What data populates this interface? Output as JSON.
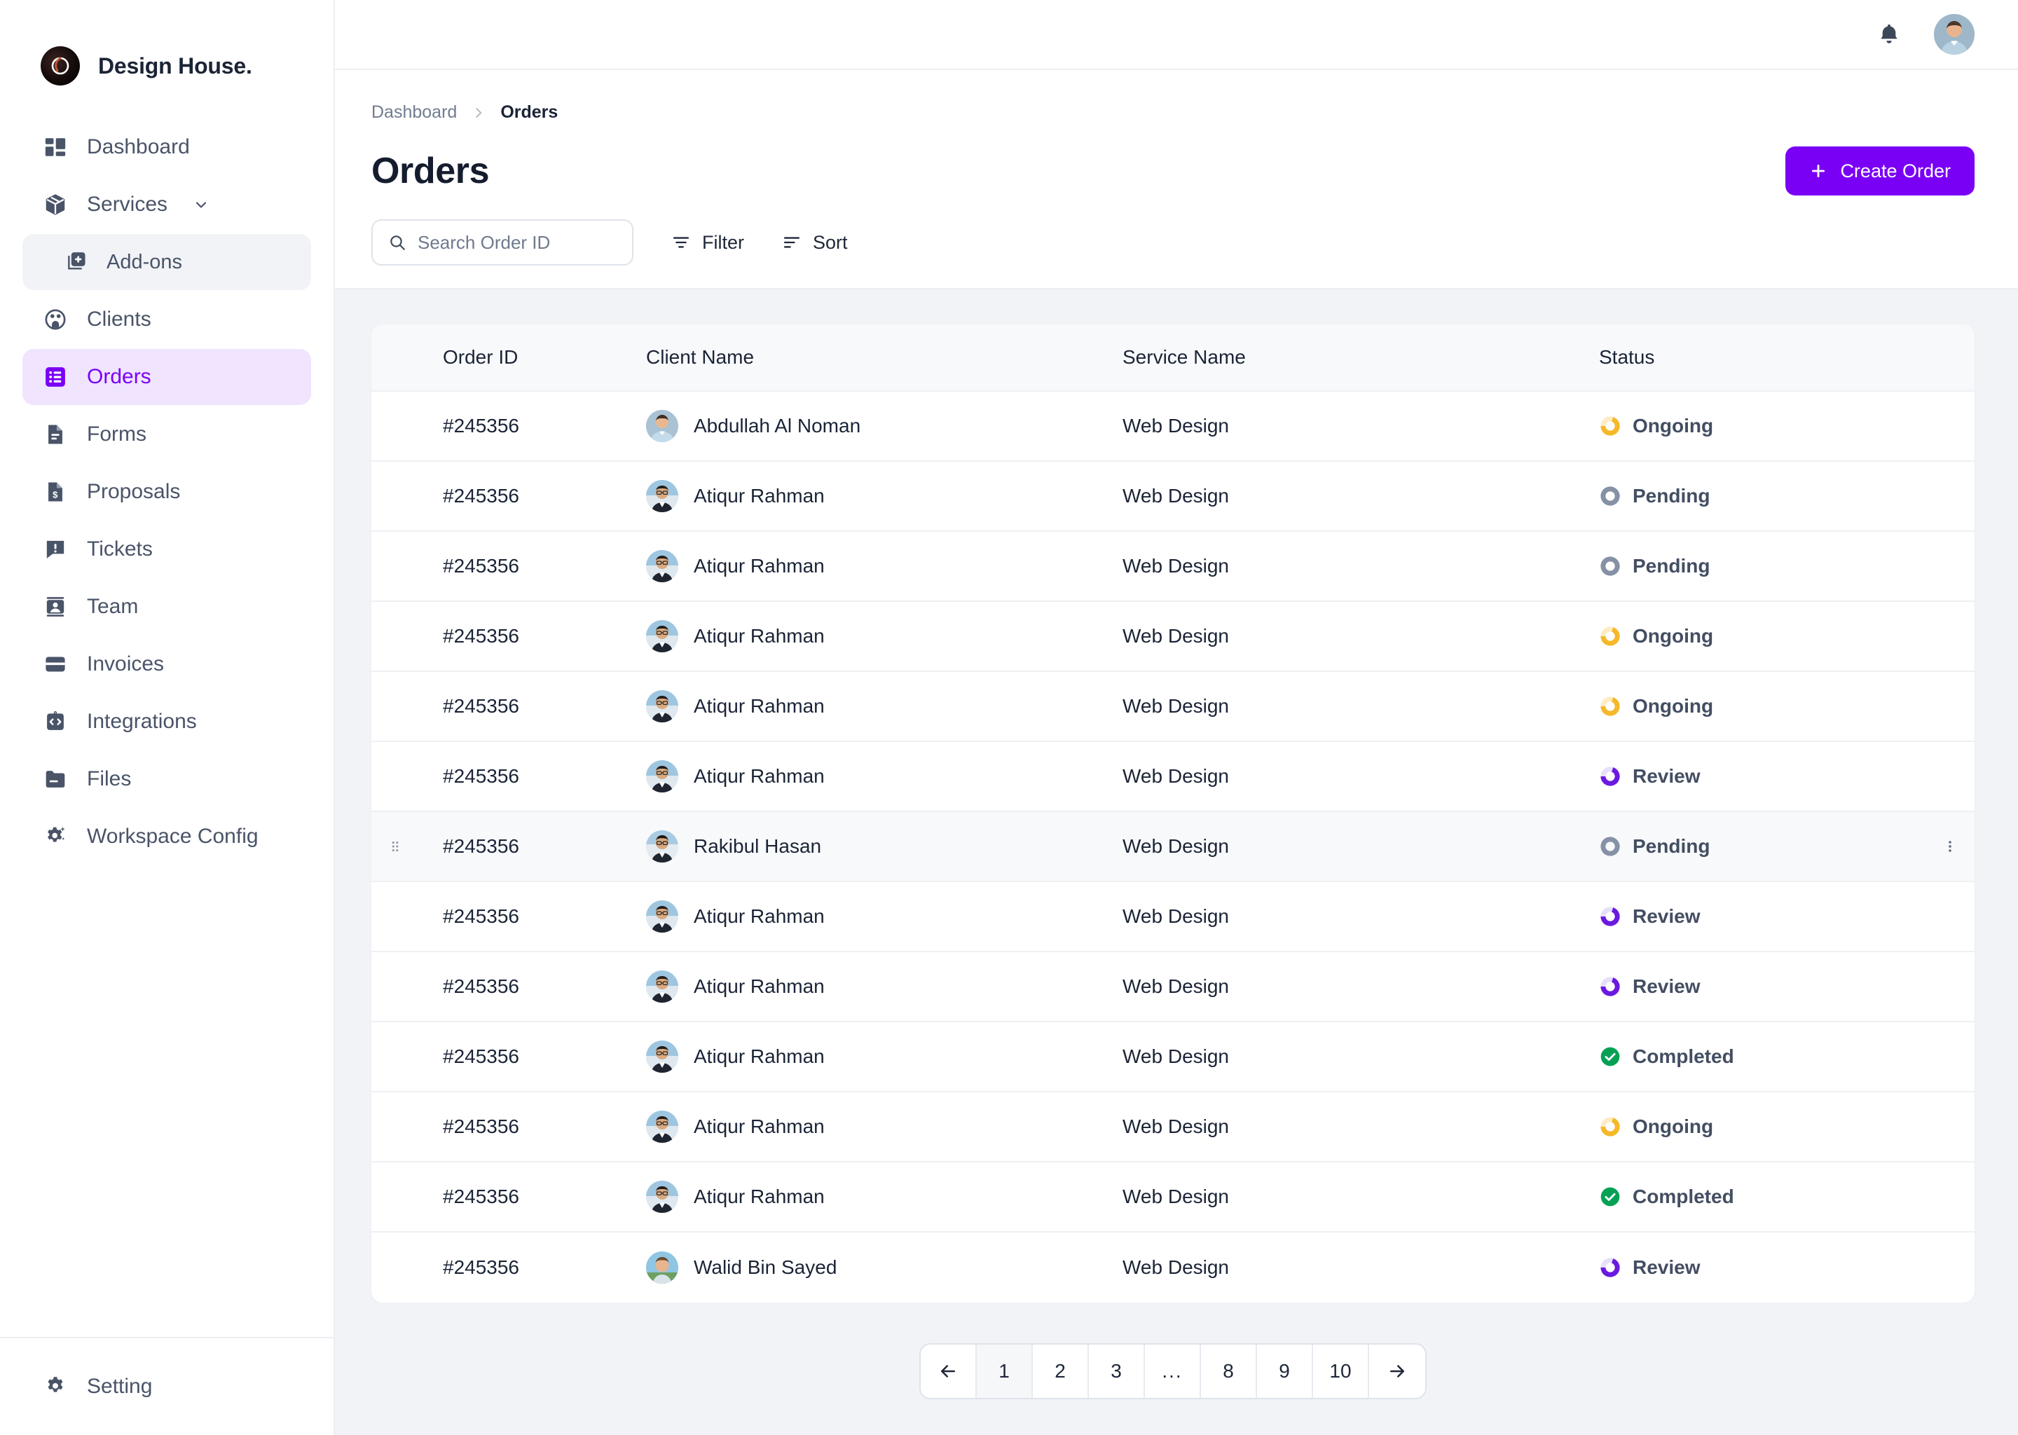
{
  "brand": {
    "name": "Design House.",
    "logo_icon": "brand-logo-icon"
  },
  "sidebar": {
    "items": [
      {
        "label": "Dashboard",
        "icon": "dashboard-grid-icon",
        "state": "default",
        "level": "top"
      },
      {
        "label": "Services",
        "icon": "package-box-icon",
        "state": "default",
        "level": "top",
        "chevron": "chevron-down-icon"
      },
      {
        "label": "Add-ons",
        "icon": "add-ons-plus-square-icon",
        "state": "selected-grey",
        "level": "child"
      },
      {
        "label": "Clients",
        "icon": "clients-people-circle-icon",
        "state": "default",
        "level": "top"
      },
      {
        "label": "Orders",
        "icon": "orders-list-icon",
        "state": "selected-active",
        "level": "top"
      },
      {
        "label": "Forms",
        "icon": "forms-document-icon",
        "state": "default",
        "level": "top"
      },
      {
        "label": "Proposals",
        "icon": "proposals-dollar-document-icon",
        "state": "default",
        "level": "top"
      },
      {
        "label": "Tickets",
        "icon": "tickets-alert-chat-icon",
        "state": "default",
        "level": "top"
      },
      {
        "label": "Team",
        "icon": "team-person-card-icon",
        "state": "default",
        "level": "top"
      },
      {
        "label": "Invoices",
        "icon": "invoices-card-icon",
        "state": "default",
        "level": "top"
      },
      {
        "label": "Integrations",
        "icon": "integrations-code-clipboard-icon",
        "state": "default",
        "level": "top"
      },
      {
        "label": "Files",
        "icon": "files-folder-icon",
        "state": "default",
        "level": "top"
      },
      {
        "label": "Workspace Config",
        "icon": "workspace-config-gear-sparkle-icon",
        "state": "default",
        "level": "top"
      }
    ],
    "footer": {
      "label": "Setting",
      "icon": "gear-icon"
    }
  },
  "topbar": {
    "notification_icon": "bell-icon",
    "avatar_icon": "user-avatar"
  },
  "breadcrumb": {
    "root": "Dashboard",
    "separator_icon": "chevron-right-icon",
    "current": "Orders"
  },
  "header": {
    "title": "Orders"
  },
  "create_button": {
    "label": "Create Order",
    "icon": "plus-icon"
  },
  "toolbar": {
    "search": {
      "placeholder": "Search Order ID",
      "value": "",
      "icon": "search-icon"
    },
    "filter": {
      "label": "Filter",
      "icon": "filter-icon"
    },
    "sort": {
      "label": "Sort",
      "icon": "sort-icon"
    }
  },
  "table": {
    "columns": [
      "Order ID",
      "Client Name",
      "Service Name",
      "Status"
    ],
    "rows": [
      {
        "order_id": "#245356",
        "client": "Abdullah Al Noman",
        "service": "Web Design",
        "status": "Ongoing",
        "status_type": "ongoing",
        "hovered": false
      },
      {
        "order_id": "#245356",
        "client": "Atiqur Rahman",
        "service": "Web Design",
        "status": "Pending",
        "status_type": "pending",
        "hovered": false
      },
      {
        "order_id": "#245356",
        "client": "Atiqur Rahman",
        "service": "Web Design",
        "status": "Pending",
        "status_type": "pending",
        "hovered": false
      },
      {
        "order_id": "#245356",
        "client": "Atiqur Rahman",
        "service": "Web Design",
        "status": "Ongoing",
        "status_type": "ongoing",
        "hovered": false
      },
      {
        "order_id": "#245356",
        "client": "Atiqur Rahman",
        "service": "Web Design",
        "status": "Ongoing",
        "status_type": "ongoing",
        "hovered": false
      },
      {
        "order_id": "#245356",
        "client": "Atiqur Rahman",
        "service": "Web Design",
        "status": "Review",
        "status_type": "review",
        "hovered": false
      },
      {
        "order_id": "#245356",
        "client": "Rakibul Hasan",
        "service": "Web Design",
        "status": "Pending",
        "status_type": "pending",
        "hovered": true
      },
      {
        "order_id": "#245356",
        "client": "Atiqur Rahman",
        "service": "Web Design",
        "status": "Review",
        "status_type": "review",
        "hovered": false
      },
      {
        "order_id": "#245356",
        "client": "Atiqur Rahman",
        "service": "Web Design",
        "status": "Review",
        "status_type": "review",
        "hovered": false
      },
      {
        "order_id": "#245356",
        "client": "Atiqur Rahman",
        "service": "Web Design",
        "status": "Completed",
        "status_type": "completed",
        "hovered": false
      },
      {
        "order_id": "#245356",
        "client": "Atiqur Rahman",
        "service": "Web Design",
        "status": "Ongoing",
        "status_type": "ongoing",
        "hovered": false
      },
      {
        "order_id": "#245356",
        "client": "Atiqur Rahman",
        "service": "Web Design",
        "status": "Completed",
        "status_type": "completed",
        "hovered": false
      },
      {
        "order_id": "#245356",
        "client": "Walid Bin Sayed",
        "service": "Web Design",
        "status": "Review",
        "status_type": "review",
        "hovered": false
      }
    ]
  },
  "pagination": {
    "prev_icon": "arrow-left-icon",
    "next_icon": "arrow-right-icon",
    "pages": [
      "1",
      "2",
      "3",
      "...",
      "8",
      "9",
      "10"
    ],
    "active": "1"
  },
  "colors": {
    "accent_purple": "#7a00f5",
    "accent_purple_soft": "#f0e4fe",
    "status_ongoing": "#f5b828",
    "status_ongoing_track": "#fdecc4",
    "status_pending": "#8691a6",
    "status_pending_track": "#dfe3ea",
    "status_review": "#6a1ae0",
    "status_review_track": "#e6e0fb",
    "status_completed": "#06a155",
    "text_primary": "#1b2436",
    "text_secondary": "#4a5468",
    "canvas": "#f1f3f7",
    "border": "#eceef2"
  }
}
